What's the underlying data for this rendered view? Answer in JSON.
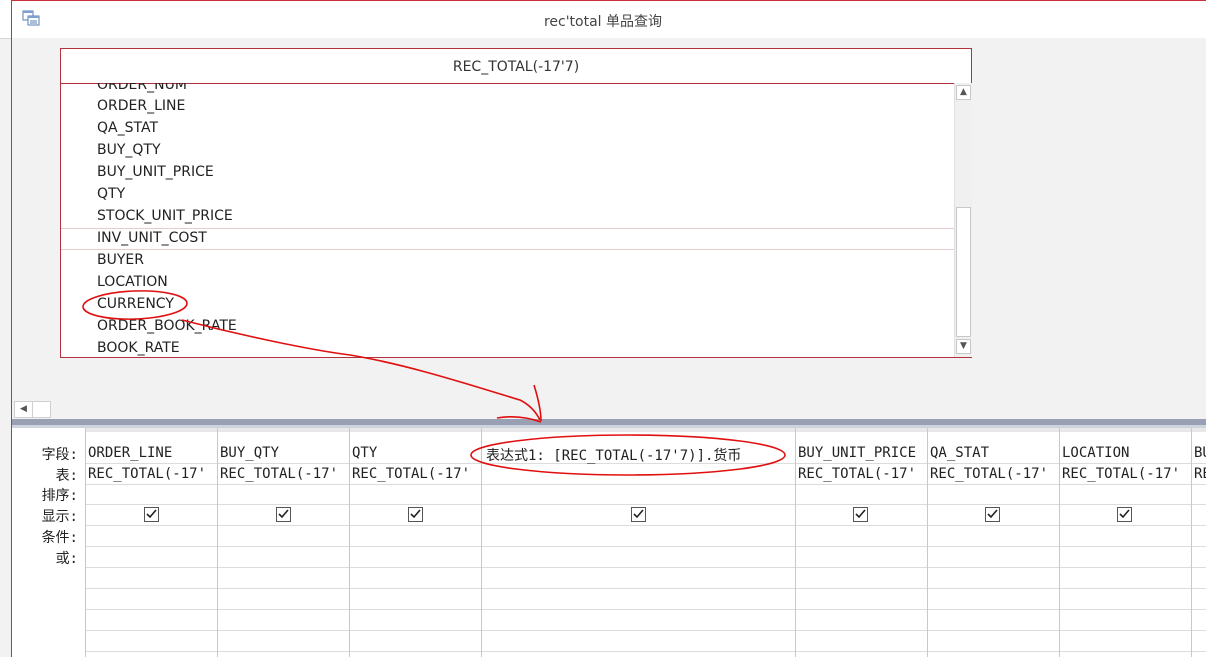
{
  "window": {
    "title": "rec'total 单品查询"
  },
  "table": {
    "title": "REC_TOTAL(-17'7)",
    "fields": [
      "ORDER_NUM",
      "ORDER_LINE",
      "QA_STAT",
      "BUY_QTY",
      "BUY_UNIT_PRICE",
      "QTY",
      "STOCK_UNIT_PRICE",
      "INV_UNIT_COST",
      "BUYER",
      "LOCATION",
      "CURRENCY",
      "ORDER_BOOK_RATE",
      "BOOK_RATE"
    ]
  },
  "grid": {
    "row_labels": {
      "field": "字段:",
      "table": "表:",
      "sort": "排序:",
      "show": "显示:",
      "criteria": "条件:",
      "or": "或:"
    },
    "columns": [
      {
        "field": "ORDER_LINE",
        "table": "REC_TOTAL(-17'",
        "show": true
      },
      {
        "field": "BUY_QTY",
        "table": "REC_TOTAL(-17'",
        "show": true
      },
      {
        "field": "QTY",
        "table": "REC_TOTAL(-17'",
        "show": true
      },
      {
        "field": "表达式1: [REC_TOTAL(-17'7)].货币",
        "table": "",
        "show": true
      },
      {
        "field": "BUY_UNIT_PRICE",
        "table": "REC_TOTAL(-17'",
        "show": true
      },
      {
        "field": "QA_STAT",
        "table": "REC_TOTAL(-17'",
        "show": true
      },
      {
        "field": "LOCATION",
        "table": "REC_TOTAL(-17'",
        "show": true
      },
      {
        "field": "BU",
        "table": "RE",
        "show": false
      }
    ]
  },
  "icons": {
    "app": "query-design-icon",
    "check": "checkmark-icon",
    "scroll_up": "arrow-up-icon",
    "scroll_down": "arrow-down-icon",
    "scroll_left": "arrow-left-icon"
  },
  "colors": {
    "frame": "#c9303a",
    "annotation": "#e01010"
  }
}
